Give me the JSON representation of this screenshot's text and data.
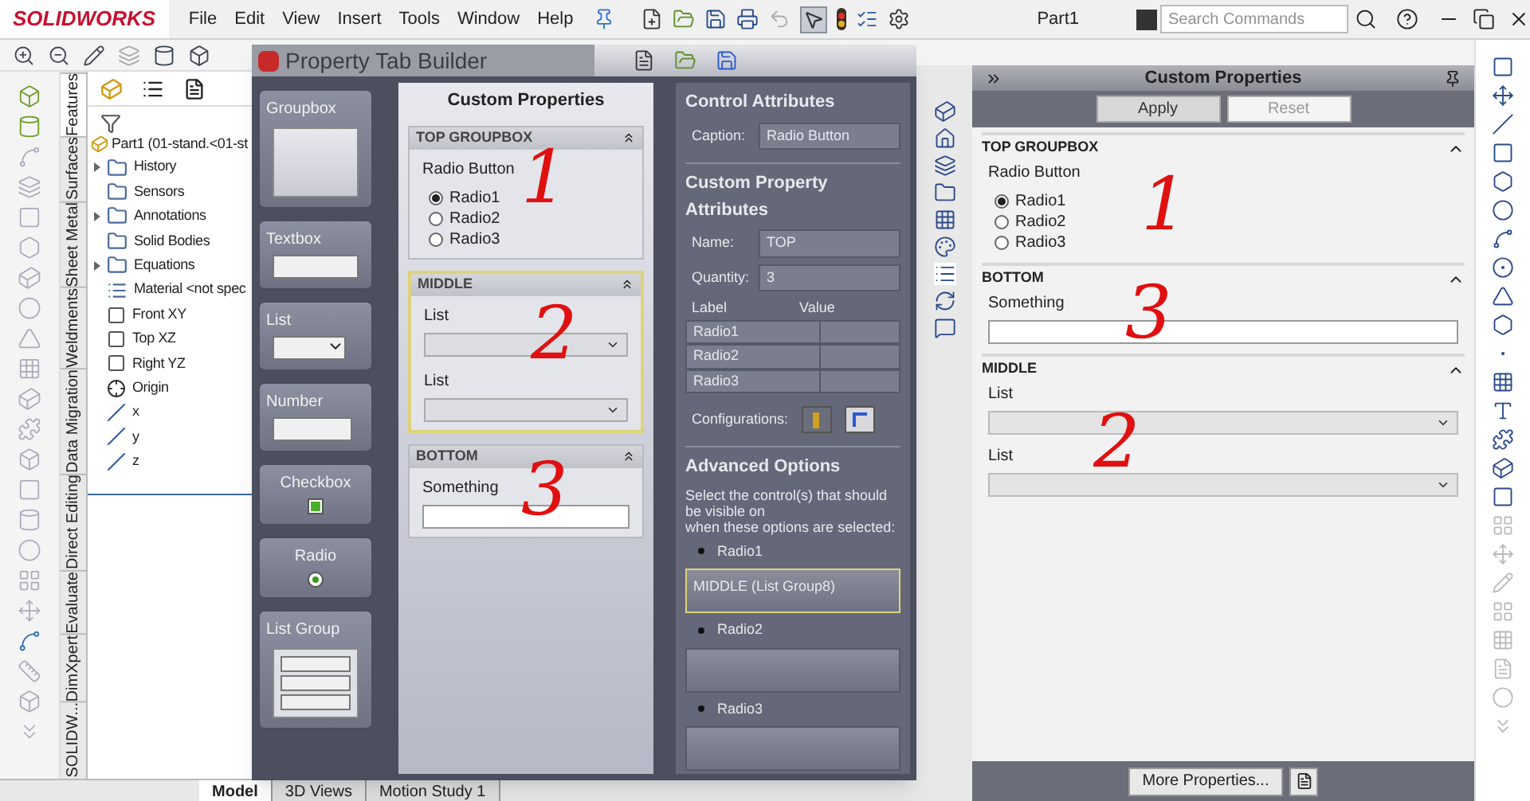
{
  "app": {
    "logo": "SOLIDWORKS",
    "menu": [
      "File",
      "Edit",
      "View",
      "Insert",
      "Tools",
      "Window",
      "Help"
    ],
    "document_title": "Part1",
    "search": {
      "placeholder": "Search Commands"
    }
  },
  "command_tabs": [
    {
      "label": "Features",
      "selected": true
    },
    {
      "label": "Surfaces",
      "selected": false
    },
    {
      "label": "Sheet Metal",
      "selected": false
    },
    {
      "label": "Weldments",
      "selected": false
    },
    {
      "label": "Data Migration",
      "selected": false
    },
    {
      "label": "Direct Editing",
      "selected": false
    },
    {
      "label": "Evaluate",
      "selected": false
    },
    {
      "label": "DimXpert",
      "selected": false
    },
    {
      "label": "SOLIDW...",
      "selected": false
    }
  ],
  "feature_tree": {
    "root": "Part1  (01-stand.<01-st",
    "items": [
      {
        "label": "History",
        "expandable": true,
        "kind": "folder"
      },
      {
        "label": "Sensors",
        "expandable": false,
        "kind": "folder"
      },
      {
        "label": "Annotations",
        "expandable": true,
        "kind": "folder"
      },
      {
        "label": "Solid Bodies",
        "expandable": false,
        "kind": "folder"
      },
      {
        "label": "Equations",
        "expandable": true,
        "kind": "folder"
      },
      {
        "label": "Material <not spec",
        "expandable": false,
        "kind": "material"
      },
      {
        "label": "Front XY",
        "expandable": false,
        "kind": "plane"
      },
      {
        "label": "Top XZ",
        "expandable": false,
        "kind": "plane"
      },
      {
        "label": "Right YZ",
        "expandable": false,
        "kind": "plane"
      },
      {
        "label": "Origin",
        "expandable": false,
        "kind": "origin"
      },
      {
        "label": "x",
        "expandable": false,
        "kind": "axis"
      },
      {
        "label": "y",
        "expandable": false,
        "kind": "axis"
      },
      {
        "label": "z",
        "expandable": false,
        "kind": "axis"
      }
    ]
  },
  "bottom_tabs": [
    {
      "label": "Model",
      "selected": true
    },
    {
      "label": "3D Views",
      "selected": false
    },
    {
      "label": "Motion Study 1",
      "selected": false
    }
  ],
  "tab_builder": {
    "title": "Property Tab Builder",
    "palette": [
      {
        "kind": "groupbox",
        "label": "Groupbox"
      },
      {
        "kind": "textbox",
        "label": "Textbox"
      },
      {
        "kind": "list",
        "label": "List"
      },
      {
        "kind": "number",
        "label": "Number"
      },
      {
        "kind": "checkbox",
        "label": "Checkbox",
        "checked": true
      },
      {
        "kind": "radio",
        "label": "Radio",
        "checked": true
      },
      {
        "kind": "listgroup",
        "label": "List Group"
      }
    ],
    "preview": {
      "title": "Custom Properties",
      "groups": [
        {
          "title": "TOP GROUPBOX",
          "highlighted": false,
          "annotation": "1",
          "controls": [
            {
              "kind": "radio",
              "caption": "Radio Button",
              "options": [
                {
                  "label": "Radio1",
                  "selected": true
                },
                {
                  "label": "Radio2",
                  "selected": false
                },
                {
                  "label": "Radio3",
                  "selected": false
                }
              ]
            }
          ]
        },
        {
          "title": "MIDDLE",
          "highlighted": true,
          "annotation": "2",
          "controls": [
            {
              "kind": "list",
              "caption": "List"
            },
            {
              "kind": "list",
              "caption": "List"
            }
          ]
        },
        {
          "title": "BOTTOM",
          "highlighted": false,
          "annotation": "3",
          "controls": [
            {
              "kind": "textbox",
              "caption": "Something"
            }
          ]
        }
      ]
    },
    "attributes": {
      "control_heading": "Control Attributes",
      "caption_label": "Caption:",
      "caption_value": "Radio Button",
      "custom_heading": "Custom Property Attributes",
      "name_label": "Name:",
      "name_value": "TOP",
      "quantity_label": "Quantity:",
      "quantity_value": "3",
      "columns": [
        "Label",
        "Value"
      ],
      "rows": [
        "Radio1",
        "Radio2",
        "Radio3"
      ],
      "configurations_label": "Configurations:",
      "advanced_heading": "Advanced Options",
      "advanced_lines": [
        "Select the control(s) that should be visible on",
        "when these options are selected:"
      ],
      "options": [
        {
          "label": "Radio1",
          "content": "MIDDLE (List Group8)",
          "selected": true
        },
        {
          "label": "Radio2",
          "selected": false
        },
        {
          "label": "Radio3",
          "selected": false
        }
      ]
    }
  },
  "task_pane": {
    "title": "Custom Properties",
    "buttons": [
      {
        "label": "Apply",
        "disabled": false
      },
      {
        "label": "Reset",
        "disabled": true
      }
    ],
    "groups": [
      {
        "title": "TOP GROUPBOX",
        "annotation": "1",
        "controls": [
          {
            "kind": "radio",
            "caption": "Radio Button",
            "options": [
              {
                "label": "Radio1",
                "selected": true
              },
              {
                "label": "Radio2",
                "selected": false
              },
              {
                "label": "Radio3",
                "selected": false
              }
            ]
          }
        ]
      },
      {
        "title": "BOTTOM",
        "annotation": "3",
        "controls": [
          {
            "kind": "textbox",
            "caption": "Something"
          }
        ]
      },
      {
        "title": "MIDDLE",
        "annotation": "2",
        "controls": [
          {
            "kind": "list",
            "caption": "List"
          },
          {
            "kind": "list",
            "caption": "List"
          }
        ]
      }
    ],
    "more_button": "More Properties..."
  }
}
